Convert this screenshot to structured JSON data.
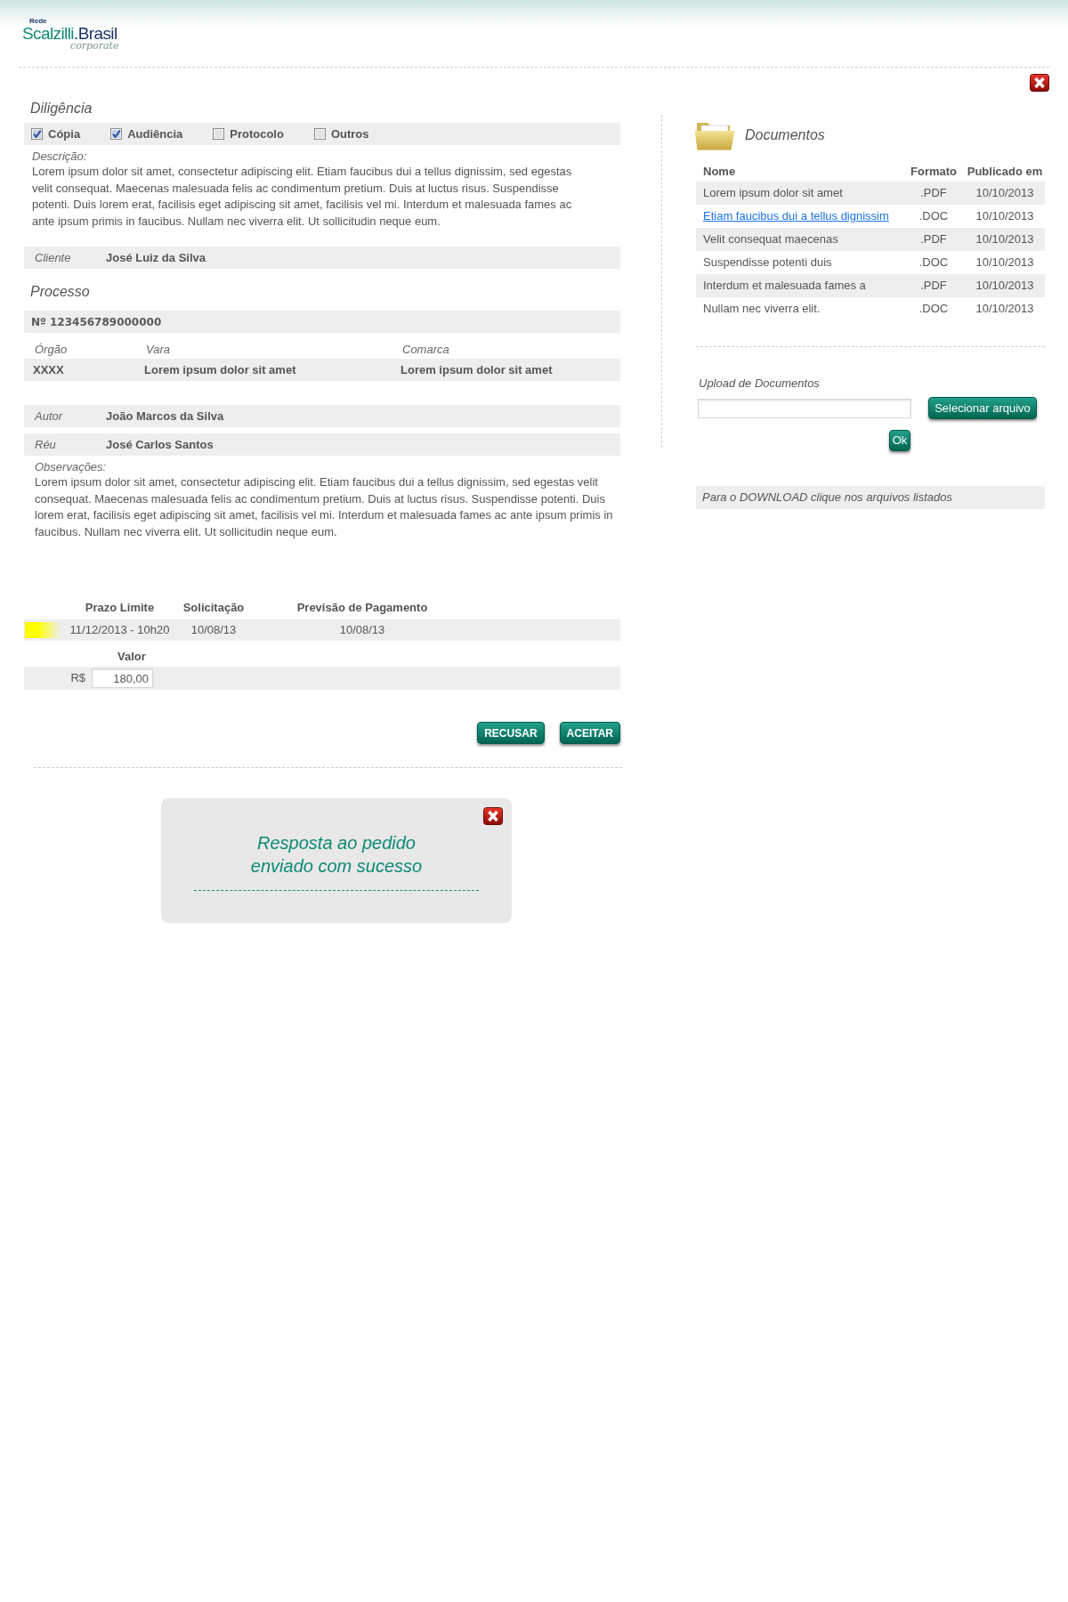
{
  "header": {
    "logo": {
      "small": "Rede",
      "brand_left": "Scalzilli",
      "brand_right": ".Brasil",
      "tagline": "corporate"
    }
  },
  "diligencia": {
    "title": "Diligência",
    "options": [
      {
        "label": "Cópia",
        "checked": true
      },
      {
        "label": "Audiência",
        "checked": true
      },
      {
        "label": "Protocolo",
        "checked": false
      },
      {
        "label": "Outros",
        "checked": false
      }
    ],
    "description_label": "Descrição:",
    "description": "Lorem ipsum dolor sit amet, consectetur adipiscing elit. Etiam faucibus dui a tellus dignissim, sed egestas velit consequat. Maecenas malesuada felis ac condimentum pretium. Duis at luctus risus. Suspendisse potenti. Duis lorem erat, facilisis eget adipiscing sit amet, facilisis vel mi. Interdum et malesuada fames ac ante ipsum primis in faucibus. Nullam nec viverra elit. Ut sollicitudin neque eum."
  },
  "cliente": {
    "label": "Cliente",
    "value": "José Luiz da Silva"
  },
  "processo": {
    "title": "Processo",
    "number": "Nº 123456789000000",
    "columns": [
      {
        "header": "Órgão",
        "value": "XXXX"
      },
      {
        "header": "Vara",
        "value": "Lorem ipsum dolor sit amet"
      },
      {
        "header": "Comarca",
        "value": "Lorem ipsum dolor sit amet"
      }
    ],
    "parties": [
      {
        "label": "Autor",
        "value": "João Marcos da Silva"
      },
      {
        "label": "Réu",
        "value": "José Carlos Santos"
      }
    ],
    "observations_label": "Observações:",
    "observations": "Lorem ipsum dolor sit amet, consectetur adipiscing elit. Etiam faucibus dui a tellus dignissim, sed egestas velit consequat. Maecenas malesuada felis ac condimentum pretium. Duis at luctus risus. Suspendisse potenti. Duis lorem erat, facilisis eget adipiscing sit amet, facilisis vel mi. Interdum et malesuada fames ac ante ipsum primis in faucibus. Nullam nec viverra elit. Ut sollicitudin neque eum."
  },
  "prazos": {
    "columns": [
      {
        "header": "Prazo Limite",
        "value": "11/12/2013 - 10h20"
      },
      {
        "header": "Solicitação",
        "value": "10/08/13"
      },
      {
        "header": "Previsão de Pagamento",
        "value": "10/08/13"
      }
    ]
  },
  "valor": {
    "header": "Valor",
    "currency": "R$",
    "value": "180,00"
  },
  "actions": [
    "RECUSAR",
    "ACEITAR"
  ],
  "success_dialog": {
    "message": "Resposta ao pedido enviado com sucesso"
  },
  "documents": {
    "title": "Documentos",
    "columns": [
      "Nome",
      "Formato",
      "Publicado em"
    ],
    "rows": [
      {
        "name": "Lorem ipsum dolor sit amet",
        "format": ".PDF",
        "published": "10/10/2013",
        "hovered": false
      },
      {
        "name": "Etiam faucibus dui a tellus dignissim",
        "format": ".DOC",
        "published": "10/10/2013",
        "hovered": true
      },
      {
        "name": "Velit consequat maecenas",
        "format": ".PDF",
        "published": "10/10/2013",
        "hovered": false
      },
      {
        "name": "Suspendisse potenti duis",
        "format": ".DOC",
        "published": "10/10/2013",
        "hovered": false
      },
      {
        "name": "Interdum et malesuada fames a",
        "format": ".PDF",
        "published": "10/10/2013",
        "hovered": false
      },
      {
        "name": "Nullam nec viverra elit.",
        "format": ".DOC",
        "published": "10/10/2013",
        "hovered": false
      }
    ]
  },
  "upload": {
    "label": "Upload de Documentos",
    "select_button": "Selecionar arquivo",
    "ok_button": "Ok"
  },
  "download_hint": "Para o DOWNLOAD clique nos arquivos listados"
}
